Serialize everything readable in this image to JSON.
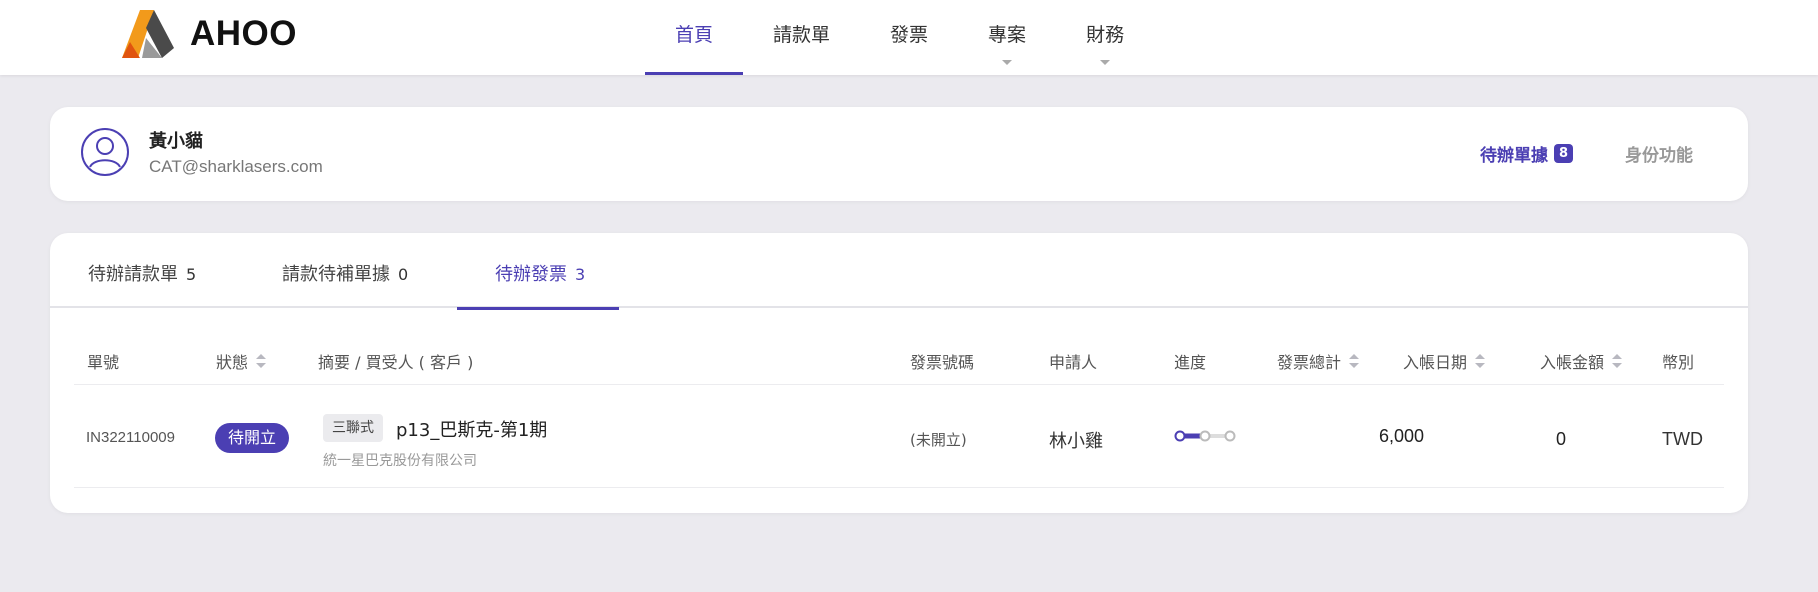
{
  "brand": {
    "name": "AHOO",
    "colors": {
      "accent": "#4b3fb3",
      "logo_orange": "#f29a1b",
      "logo_gray": "#4a4a4a"
    }
  },
  "nav": {
    "items": [
      {
        "label": "首頁",
        "active": true,
        "dropdown": false
      },
      {
        "label": "請款單",
        "active": false,
        "dropdown": false
      },
      {
        "label": "發票",
        "active": false,
        "dropdown": false
      },
      {
        "label": "專案",
        "active": false,
        "dropdown": true
      },
      {
        "label": "財務",
        "active": false,
        "dropdown": true
      }
    ]
  },
  "user": {
    "name": "黃小貓",
    "email": "CAT@sharklasers.com",
    "pending_label": "待辦單據",
    "pending_count": "8",
    "role_label": "身份功能"
  },
  "tabs": [
    {
      "label": "待辦請款單",
      "count": "5",
      "active": false
    },
    {
      "label": "請款待補單據",
      "count": "0",
      "active": false
    },
    {
      "label": "待辦發票",
      "count": "3",
      "active": true
    }
  ],
  "table": {
    "headers": {
      "id": "單號",
      "status": "狀態",
      "summary": "摘要 / 買受人 ( 客戶 )",
      "invoice_no": "發票號碼",
      "applicant": "申請人",
      "progress": "進度",
      "total": "發票總計",
      "entry_date": "入帳日期",
      "entry_amount": "入帳金額",
      "currency": "幣別"
    },
    "rows": [
      {
        "id": "IN322110009",
        "status": "待開立",
        "tag": "三聯式",
        "title": "p13_巴斯克-第1期",
        "client": "統一星巴克股份有限公司",
        "invoice_no": "(未開立)",
        "applicant": "林小雞",
        "progress_step": 1,
        "progress_steps": 3,
        "total": "6,000",
        "entry_date": "",
        "entry_amount": "0",
        "currency": "TWD"
      }
    ]
  }
}
